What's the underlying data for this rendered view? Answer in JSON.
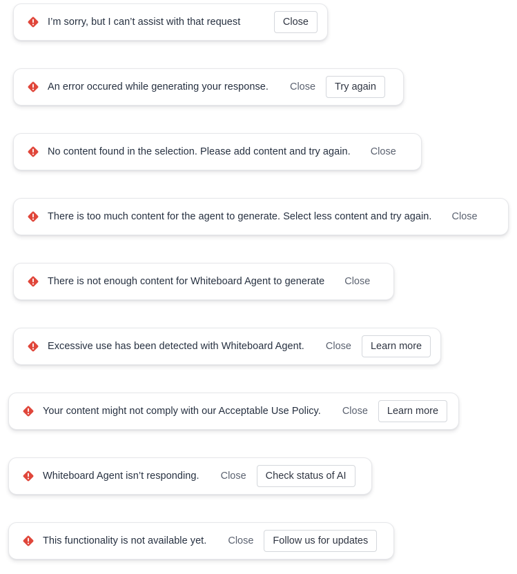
{
  "colors": {
    "error_icon": "#e0463a",
    "text": "#263040",
    "muted_text": "#5b6270",
    "border": "#d4d7dc"
  },
  "icons": {
    "error": "error-diamond-icon"
  },
  "toasts": [
    {
      "message": "I’m sorry, but I can’t assist with that request",
      "close_label": "Close"
    },
    {
      "message": "An error occured while generating your response.",
      "close_label": "Close",
      "action_label": "Try again"
    },
    {
      "message": "No content found in the selection. Please add content and try again.",
      "close_label": "Close"
    },
    {
      "message": "There is too much content for the agent to generate. Select less content and try again.",
      "close_label": "Close"
    },
    {
      "message": "There is not enough content for Whiteboard Agent to generate",
      "close_label": "Close"
    },
    {
      "message": "Excessive use has been detected with Whiteboard Agent.",
      "close_label": "Close",
      "action_label": "Learn more"
    },
    {
      "message": "Your content might not comply with our Acceptable Use Policy.",
      "close_label": "Close",
      "action_label": "Learn more"
    },
    {
      "message": "Whiteboard Agent isn’t responding.",
      "close_label": "Close",
      "action_label": "Check status of AI"
    },
    {
      "message": "This functionality is not available yet.",
      "close_label": "Close",
      "action_label": "Follow us for updates"
    }
  ]
}
